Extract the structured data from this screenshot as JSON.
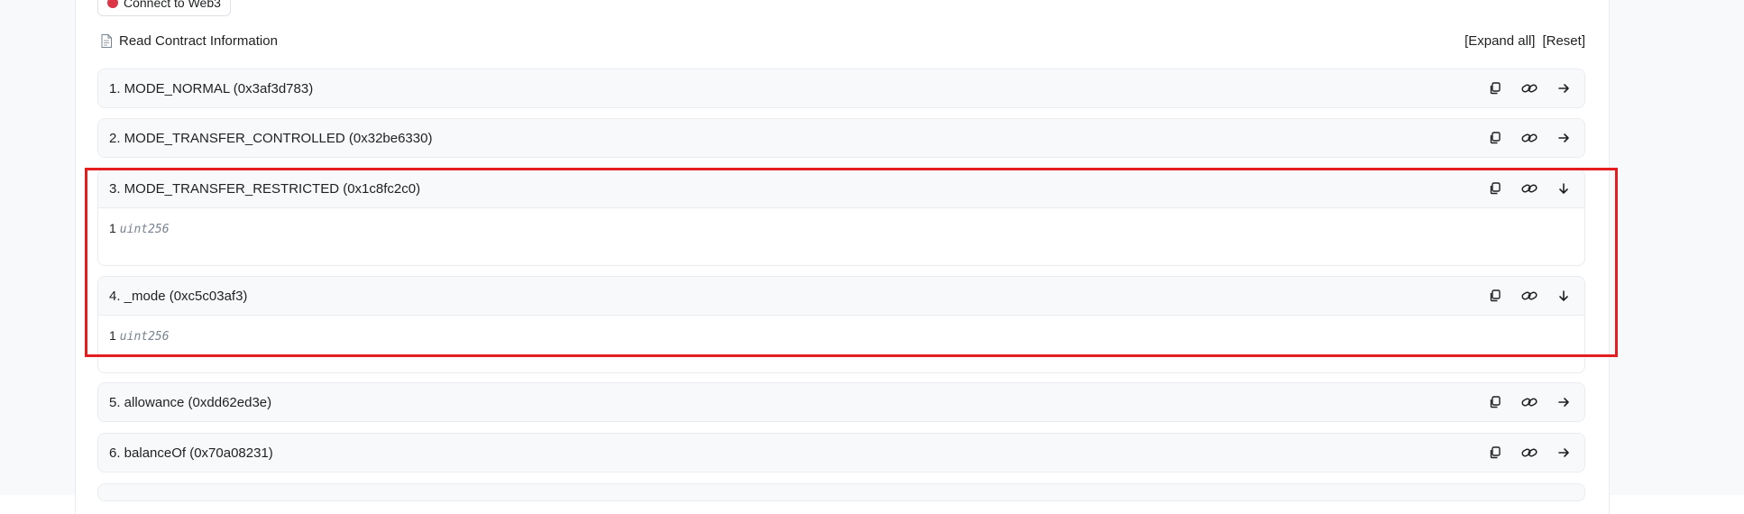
{
  "connect_button": {
    "label": "Connect to Web3",
    "status_color": "#dc3545"
  },
  "header": {
    "title": "Read Contract Information",
    "expand_all": "[Expand all]",
    "reset": "[Reset]"
  },
  "functions": [
    {
      "label": "1. MODE_NORMAL (0x3af3d783)",
      "expanded": false
    },
    {
      "label": "2. MODE_TRANSFER_CONTROLLED (0x32be6330)",
      "expanded": false
    },
    {
      "label": "3. MODE_TRANSFER_RESTRICTED (0x1c8fc2c0)",
      "expanded": true,
      "result_value": "1",
      "result_type": "uint256"
    },
    {
      "label": "4. _mode (0xc5c03af3)",
      "expanded": true,
      "result_value": "1",
      "result_type": "uint256"
    },
    {
      "label": "5. allowance (0xdd62ed3e)",
      "expanded": false
    },
    {
      "label": "6. balanceOf (0x70a08231)",
      "expanded": false
    },
    {
      "label": "",
      "expanded": false
    }
  ],
  "highlight_color": "#e41e1e"
}
